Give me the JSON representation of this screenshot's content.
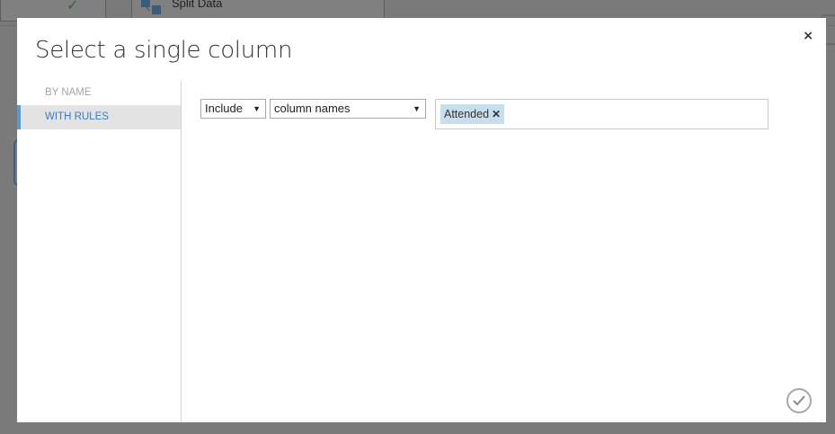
{
  "background": {
    "module_label": "Split Data",
    "check_icon": "check-icon"
  },
  "dialog": {
    "title": "Select a single column",
    "close_label": "×",
    "nav": [
      {
        "label": "BY NAME",
        "active": false
      },
      {
        "label": "WITH RULES",
        "active": true
      }
    ],
    "rule": {
      "mode_value": "Include",
      "column_type_value": "column names",
      "selected_tags": [
        {
          "label": "Attended",
          "remove_label": "✕"
        }
      ]
    },
    "ok_icon": "check-circle-icon"
  },
  "colors": {
    "accent": "#3e7bc2",
    "active_nav_bg": "#e3e3e3",
    "tag_bg": "#c7dfed",
    "overlay": "#7a7a7a"
  }
}
